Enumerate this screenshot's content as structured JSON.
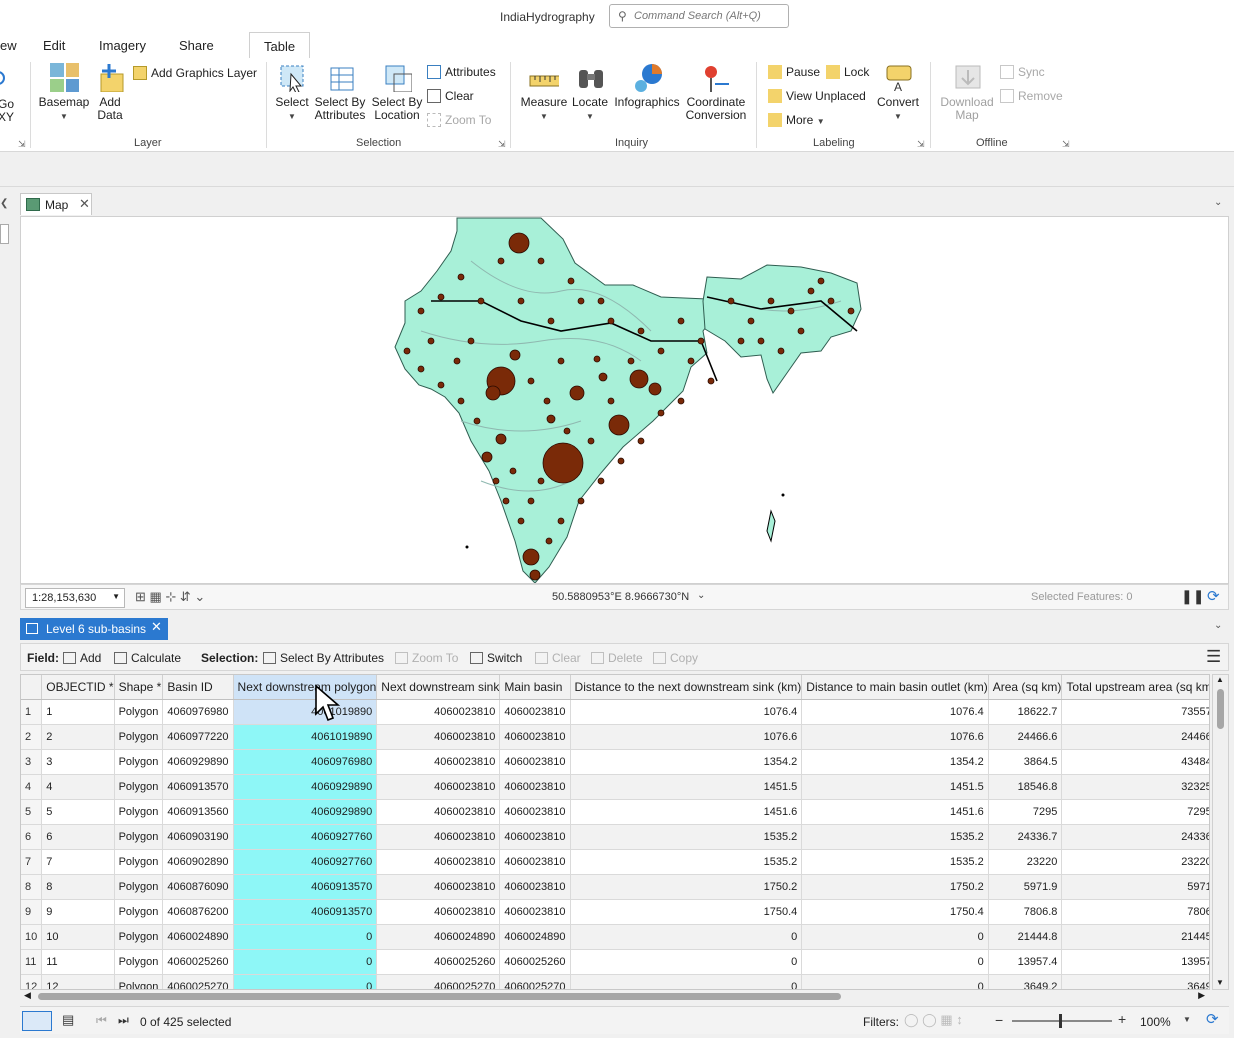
{
  "app": {
    "title": "IndiaHydrography",
    "search_placeholder": "Command Search (Alt+Q)"
  },
  "ribbon_tabs": [
    "ew",
    "Edit",
    "Imagery",
    "Share",
    "Table"
  ],
  "ribbon": {
    "go_xy": "Go\nXY",
    "layer": {
      "label": "Layer",
      "basemap": "Basemap",
      "add_data": "Add\nData",
      "add_graphics_layer": "Add Graphics Layer"
    },
    "selection": {
      "label": "Selection",
      "select": "Select",
      "select_by_attributes": "Select By\nAttributes",
      "select_by_location": "Select By\nLocation",
      "attributes": "Attributes",
      "clear": "Clear",
      "zoom_to": "Zoom To"
    },
    "inquiry": {
      "label": "Inquiry",
      "measure": "Measure",
      "locate": "Locate",
      "infographics": "Infographics",
      "coordinate_conversion": "Coordinate\nConversion"
    },
    "labeling": {
      "label": "Labeling",
      "pause": "Pause",
      "lock": "Lock",
      "view_unplaced": "View Unplaced",
      "more": "More",
      "convert": "Convert"
    },
    "offline": {
      "label": "Offline",
      "download_map": "Download\nMap",
      "sync": "Sync",
      "remove": "Remove"
    }
  },
  "map_view": {
    "tab_label": "Map",
    "scale": "1:28,153,630",
    "coordinates": "50.5880953°E 8.9666730°N",
    "selected_features": "Selected Features: 0"
  },
  "table_view": {
    "tab_label": "Level 6 sub-basins",
    "toolbar": {
      "field_label": "Field:",
      "add": "Add",
      "calculate": "Calculate",
      "selection_label": "Selection:",
      "select_by_attributes": "Select By Attributes",
      "zoom_to": "Zoom To",
      "switch": "Switch",
      "clear": "Clear",
      "delete": "Delete",
      "copy": "Copy"
    },
    "columns": [
      "OBJECTID *",
      "Shape *",
      "Basin ID",
      "Next downstream polygon",
      "Next downstream sink",
      "Main basin",
      "Distance to the next downstream sink (km)",
      "Distance to main basin outlet (km)",
      "Area (sq km)",
      "Total upstream area (sq km)"
    ],
    "rows": [
      [
        "1",
        "Polygon",
        "4060976980",
        "4061019890",
        "4060023810",
        "4060023810",
        "1076.4",
        "1076.4",
        "18622.7",
        "73557"
      ],
      [
        "2",
        "Polygon",
        "4060977220",
        "4061019890",
        "4060023810",
        "4060023810",
        "1076.6",
        "1076.6",
        "24466.6",
        "24466"
      ],
      [
        "3",
        "Polygon",
        "4060929890",
        "4060976980",
        "4060023810",
        "4060023810",
        "1354.2",
        "1354.2",
        "3864.5",
        "43484"
      ],
      [
        "4",
        "Polygon",
        "4060913570",
        "4060929890",
        "4060023810",
        "4060023810",
        "1451.5",
        "1451.5",
        "18546.8",
        "32325"
      ],
      [
        "5",
        "Polygon",
        "4060913560",
        "4060929890",
        "4060023810",
        "4060023810",
        "1451.6",
        "1451.6",
        "7295",
        "7295"
      ],
      [
        "6",
        "Polygon",
        "4060903190",
        "4060927760",
        "4060023810",
        "4060023810",
        "1535.2",
        "1535.2",
        "24336.7",
        "24336"
      ],
      [
        "7",
        "Polygon",
        "4060902890",
        "4060927760",
        "4060023810",
        "4060023810",
        "1535.2",
        "1535.2",
        "23220",
        "23220"
      ],
      [
        "8",
        "Polygon",
        "4060876090",
        "4060913570",
        "4060023810",
        "4060023810",
        "1750.2",
        "1750.2",
        "5971.9",
        "5971"
      ],
      [
        "9",
        "Polygon",
        "4060876200",
        "4060913570",
        "4060023810",
        "4060023810",
        "1750.4",
        "1750.4",
        "7806.8",
        "7806"
      ],
      [
        "10",
        "Polygon",
        "4060024890",
        "0",
        "4060024890",
        "4060024890",
        "0",
        "0",
        "21444.8",
        "21445"
      ],
      [
        "11",
        "Polygon",
        "4060025260",
        "0",
        "4060025260",
        "4060025260",
        "0",
        "0",
        "13957.4",
        "13957"
      ],
      [
        "12",
        "Polygon",
        "4060025270",
        "0",
        "4060025270",
        "4060025270",
        "0",
        "0",
        "3649.2",
        "3649"
      ]
    ],
    "status": {
      "selected": "0 of 425 selected",
      "filters_label": "Filters:",
      "zoom": "100%"
    }
  },
  "colors": {
    "selection_accent": "#2b79d0",
    "highlight_cell": "#8ef7f7",
    "basin_fill": "#a8f0d8",
    "point_fill": "#7a2a08"
  }
}
